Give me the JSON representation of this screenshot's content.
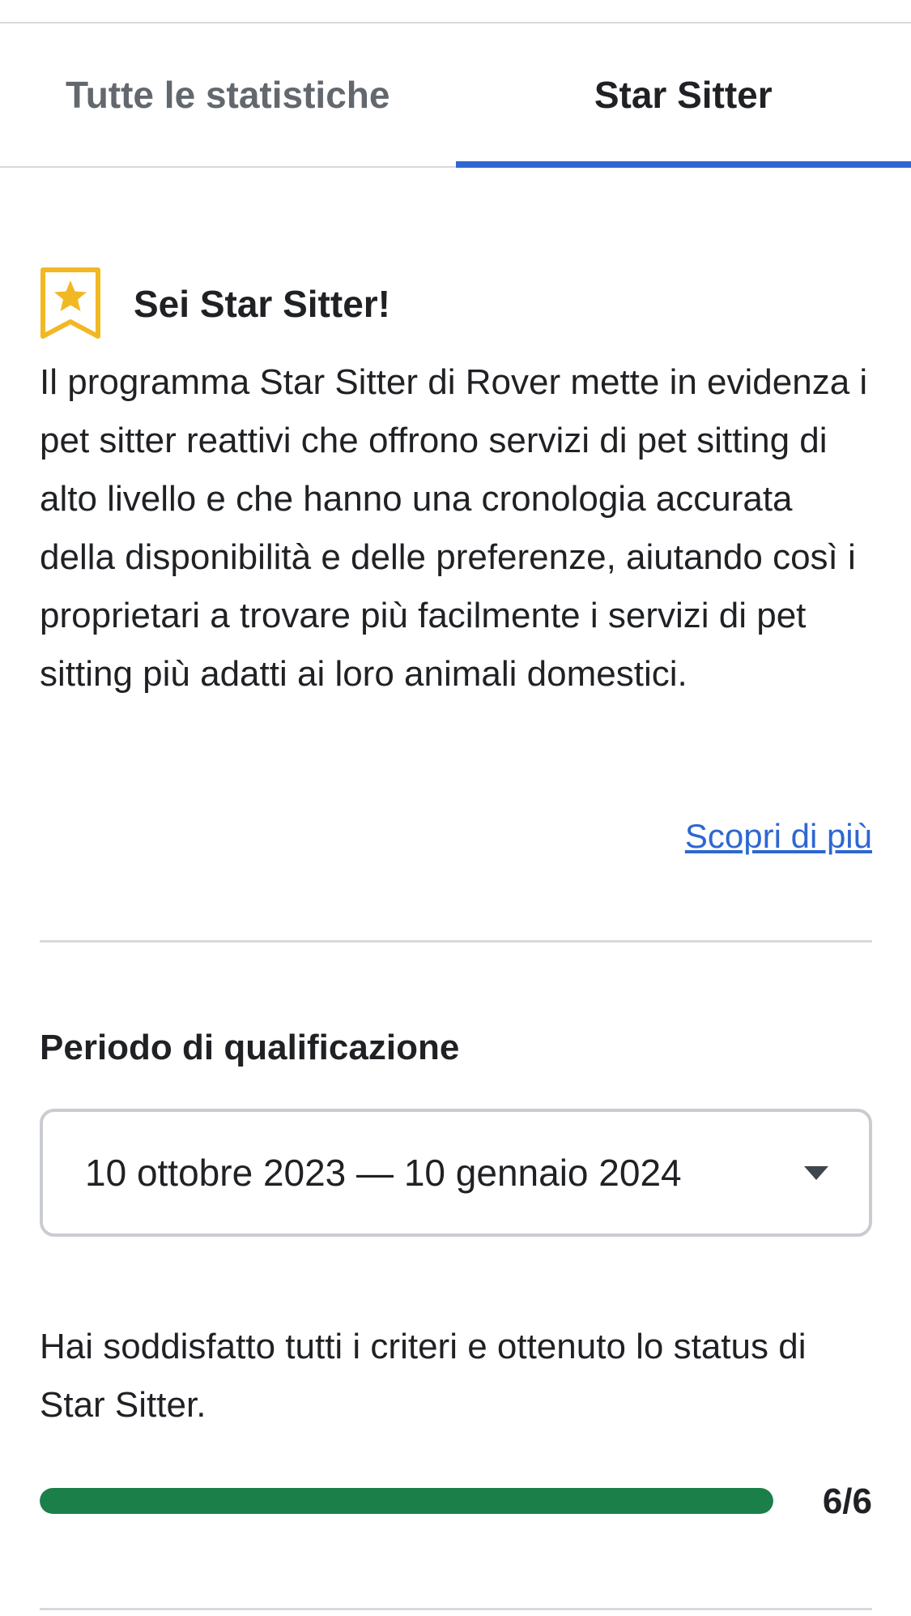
{
  "tabs": [
    {
      "label": "Tutte le statistiche",
      "active": false
    },
    {
      "label": "Star Sitter",
      "active": true
    }
  ],
  "banner": {
    "icon": "star-badge-icon",
    "title": "Sei Star Sitter!",
    "body": "Il programma Star Sitter di Rover mette in evidenza i pet sitter reattivi che offrono servizi di pet sitting di alto livello e che hanno una cronologia accurata della disponibilità e delle preferenze, aiutando così i proprietari a trovare più facilmente i servizi di pet sitting più adatti ai loro animali domestici.",
    "link": "Scopri di più"
  },
  "qualification": {
    "label": "Periodo di qualificazione",
    "selected_period": "10 ottobre 2023 — 10 gennaio 2024"
  },
  "status": {
    "text": "Hai soddisfatto tutti i criteri e ottenuto lo status di Star Sitter.",
    "progress_fraction": 1.0,
    "count_label": "6/6"
  },
  "colors": {
    "accent": "#2e67d1",
    "badge": "#f2b824",
    "progress": "#1b7f4a"
  }
}
